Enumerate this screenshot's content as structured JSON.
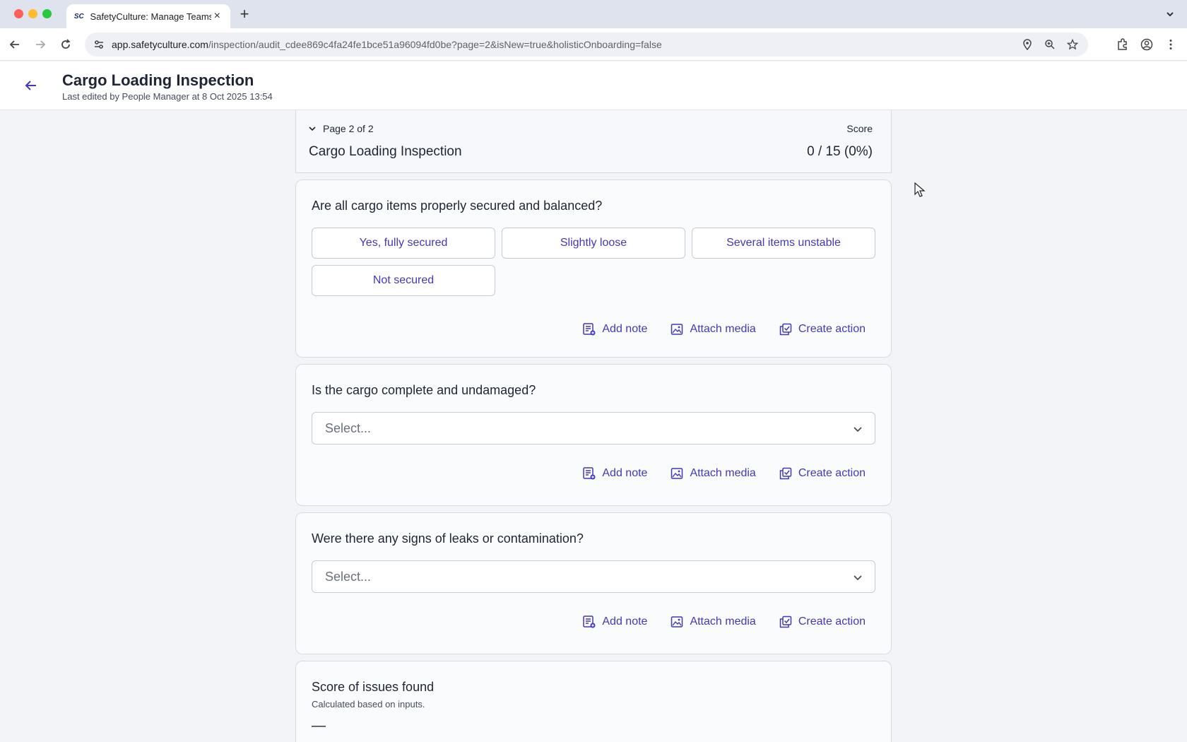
{
  "browser": {
    "tab_title": "SafetyCulture: Manage Teams",
    "favicon_text": "SC",
    "url_host": "app.safetyculture.com",
    "url_path": "/inspection/audit_cdee869c4fa24fe1bce51a96094fd0be?page=2&isNew=true&holisticOnboarding=false"
  },
  "header": {
    "title": "Cargo Loading Inspection",
    "last_edited": "Last edited by People Manager at 8 Oct 2025 13:54"
  },
  "page_panel": {
    "page_indicator": "Page 2 of 2",
    "score_label": "Score",
    "section_title": "Cargo Loading Inspection",
    "score_value": "0 / 15 (0%)"
  },
  "actions": {
    "add_note": "Add note",
    "attach_media": "Attach media",
    "create_action": "Create action"
  },
  "questions": [
    {
      "text": "Are all cargo items properly secured and balanced?",
      "options": [
        "Yes, fully secured",
        "Slightly loose",
        "Several items unstable",
        "Not secured"
      ]
    },
    {
      "text": "Is the cargo complete and undamaged?",
      "placeholder": "Select..."
    },
    {
      "text": "Were there any signs of leaks or contamination?",
      "placeholder": "Select..."
    }
  ],
  "score_card": {
    "title": "Score of issues found",
    "subtitle": "Calculated based on inputs.",
    "value": "—"
  },
  "colors": {
    "accent": "#4338b8",
    "background": "#f3f4f8"
  }
}
